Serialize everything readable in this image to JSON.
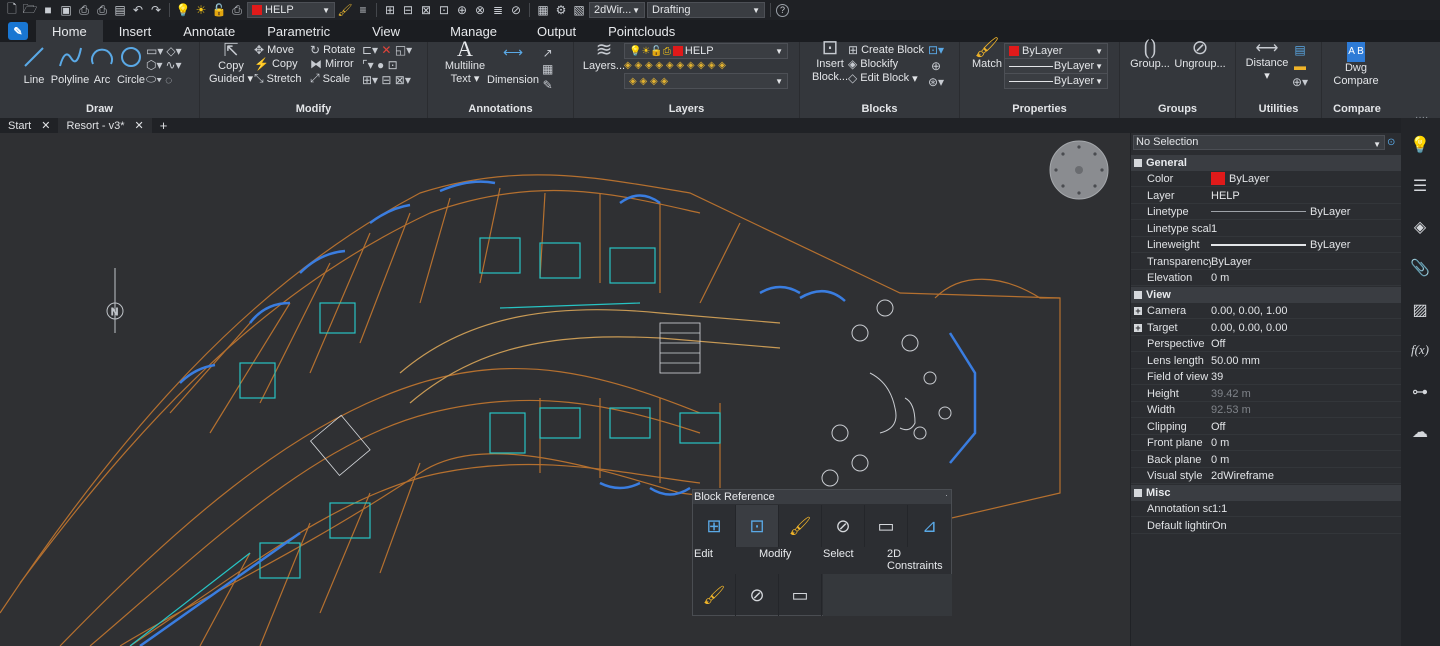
{
  "qat": {
    "layer_value": "HELP",
    "workspace_value": "2dWir...",
    "style_value": "Drafting",
    "colors": {
      "layer_swatch": "#e01a1a"
    }
  },
  "tabs": [
    "Home",
    "Insert",
    "Annotate",
    "Parametric",
    "View",
    "Manage",
    "Output",
    "Pointclouds"
  ],
  "ribbon": {
    "draw": {
      "title": "Draw",
      "line": "Line",
      "polyline": "Polyline",
      "arc": "Arc",
      "circle": "Circle"
    },
    "modify": {
      "title": "Modify",
      "copy_guided_1": "Copy",
      "copy_guided_2": "Guided",
      "move": "Move",
      "copy": "Copy",
      "stretch": "Stretch",
      "rotate": "Rotate",
      "mirror": "Mirror",
      "scale": "Scale"
    },
    "annotations": {
      "title": "Annotations",
      "mtext_1": "Multiline",
      "mtext_2": "Text",
      "dimension": "Dimension"
    },
    "layers": {
      "title": "Layers",
      "layers_btn": "Layers...",
      "current_layer": "HELP"
    },
    "blocks": {
      "title": "Blocks",
      "insert_1": "Insert",
      "insert_2": "Block...",
      "create": "Create Block",
      "blockify": "Blockify",
      "edit": "Edit Block"
    },
    "properties": {
      "title": "Properties",
      "match": "Match",
      "color": "ByLayer",
      "linetype": "ByLayer",
      "lineweight": "ByLayer"
    },
    "groups": {
      "title": "Groups",
      "group": "Group...",
      "ungroup": "Ungroup..."
    },
    "utilities": {
      "title": "Utilities",
      "distance": "Distance"
    },
    "compare": {
      "title": "Compare",
      "dwg_1": "Dwg",
      "dwg_2": "Compare"
    }
  },
  "file_tabs": [
    "Start",
    "Resort - v3*"
  ],
  "properties_panel": {
    "selection": "No Selection",
    "sections": [
      {
        "title": "General",
        "rows": [
          {
            "key": "Color",
            "value": "ByLayer"
          },
          {
            "key": "Layer",
            "value": "HELP"
          },
          {
            "key": "Linetype",
            "value": "ByLayer"
          },
          {
            "key": "Linetype scale",
            "value": "1"
          },
          {
            "key": "Lineweight",
            "value": "ByLayer"
          },
          {
            "key": "Transparency",
            "value": "ByLayer"
          },
          {
            "key": "Elevation",
            "value": "0 m"
          }
        ]
      },
      {
        "title": "View",
        "rows": [
          {
            "key": "Camera",
            "value": "0.00, 0.00, 1.00"
          },
          {
            "key": "Target",
            "value": "0.00, 0.00, 0.00"
          },
          {
            "key": "Perspective",
            "value": "Off"
          },
          {
            "key": "Lens length",
            "value": "50.00 mm"
          },
          {
            "key": "Field of view",
            "value": "39"
          },
          {
            "key": "Height",
            "value": "39.42 m"
          },
          {
            "key": "Width",
            "value": "92.53 m"
          },
          {
            "key": "Clipping",
            "value": "Off"
          },
          {
            "key": "Front plane",
            "value": "0 m"
          },
          {
            "key": "Back plane",
            "value": "0 m"
          },
          {
            "key": "Visual style",
            "value": "2dWireframe"
          }
        ]
      },
      {
        "title": "Misc",
        "rows": [
          {
            "key": "Annotation sc",
            "value": "1:1"
          },
          {
            "key": "Default lightin",
            "value": "On"
          }
        ]
      }
    ]
  },
  "quad": {
    "title": "Block Reference",
    "labels": {
      "edit": "Edit",
      "modify": "Modify",
      "select": "Select",
      "constraints_1": "2D",
      "constraints_2": "Constraints"
    }
  },
  "sidebar_icons": [
    "lightbulb-icon",
    "sliders-icon",
    "layers-icon",
    "paperclip-icon",
    "hatch-icon",
    "function-icon",
    "tree-icon",
    "cloud-upload-icon"
  ]
}
